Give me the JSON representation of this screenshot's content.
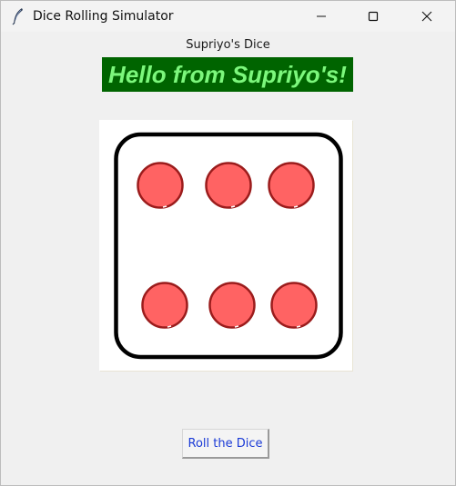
{
  "window": {
    "title": "Dice Rolling Simulator",
    "icon": "feather-icon",
    "controls": [
      "minimize-icon",
      "maximize-icon",
      "close-icon"
    ]
  },
  "header": {
    "label": "Supriyo's Dice"
  },
  "banner": {
    "text": "Hello from Supriyo's!",
    "background": "#006400",
    "text_color": "#7cf77c"
  },
  "dice": {
    "face_value": 6,
    "pip_color": "#ff6363",
    "pip_border": "#9b1c1c"
  },
  "actions": {
    "roll_label": "Roll the Dice",
    "roll_color": "#1a3ad6"
  }
}
